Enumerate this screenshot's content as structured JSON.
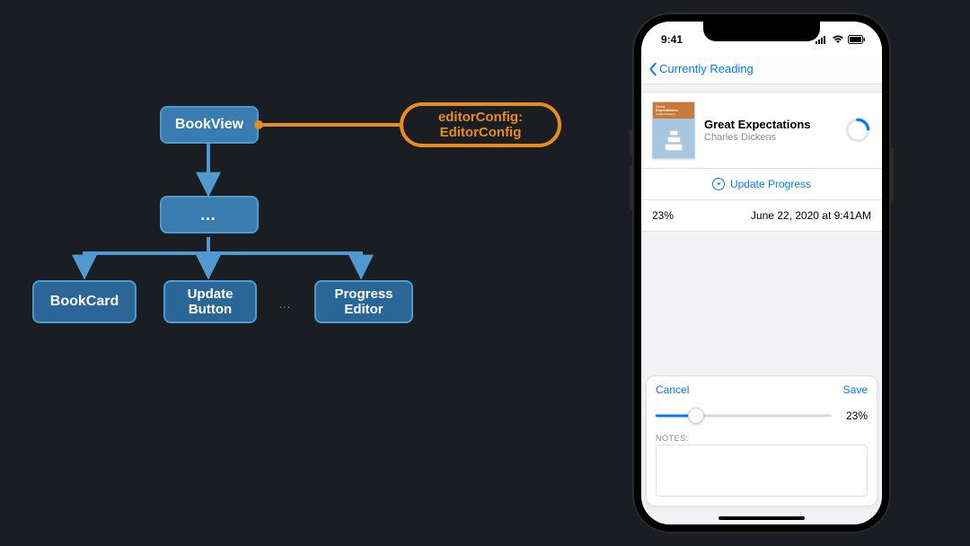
{
  "diagram": {
    "root": "BookView",
    "binding": "editorConfig:\nEditorConfig",
    "mid_ellipsis": "…",
    "children": {
      "bookcard": "BookCard",
      "update": "Update\nButton",
      "ellipsis": "…",
      "progress": "Progress\nEditor"
    }
  },
  "phone": {
    "statusbar": {
      "time": "9:41"
    },
    "nav": {
      "back": "Currently Reading"
    },
    "book": {
      "title": "Great Expectations",
      "author": "Charles Dickens",
      "cover_top1": "Great",
      "cover_top2": "Expectations",
      "cover_top3": "Charles Dickens",
      "progress_deg": 83
    },
    "update_button": "Update Progress",
    "history": {
      "percent": "23%",
      "timestamp": "June 22, 2020 at 9:41AM"
    },
    "editor": {
      "cancel": "Cancel",
      "save": "Save",
      "percent": "23%",
      "percent_num": 23,
      "notes_label": "NOTES:"
    }
  }
}
